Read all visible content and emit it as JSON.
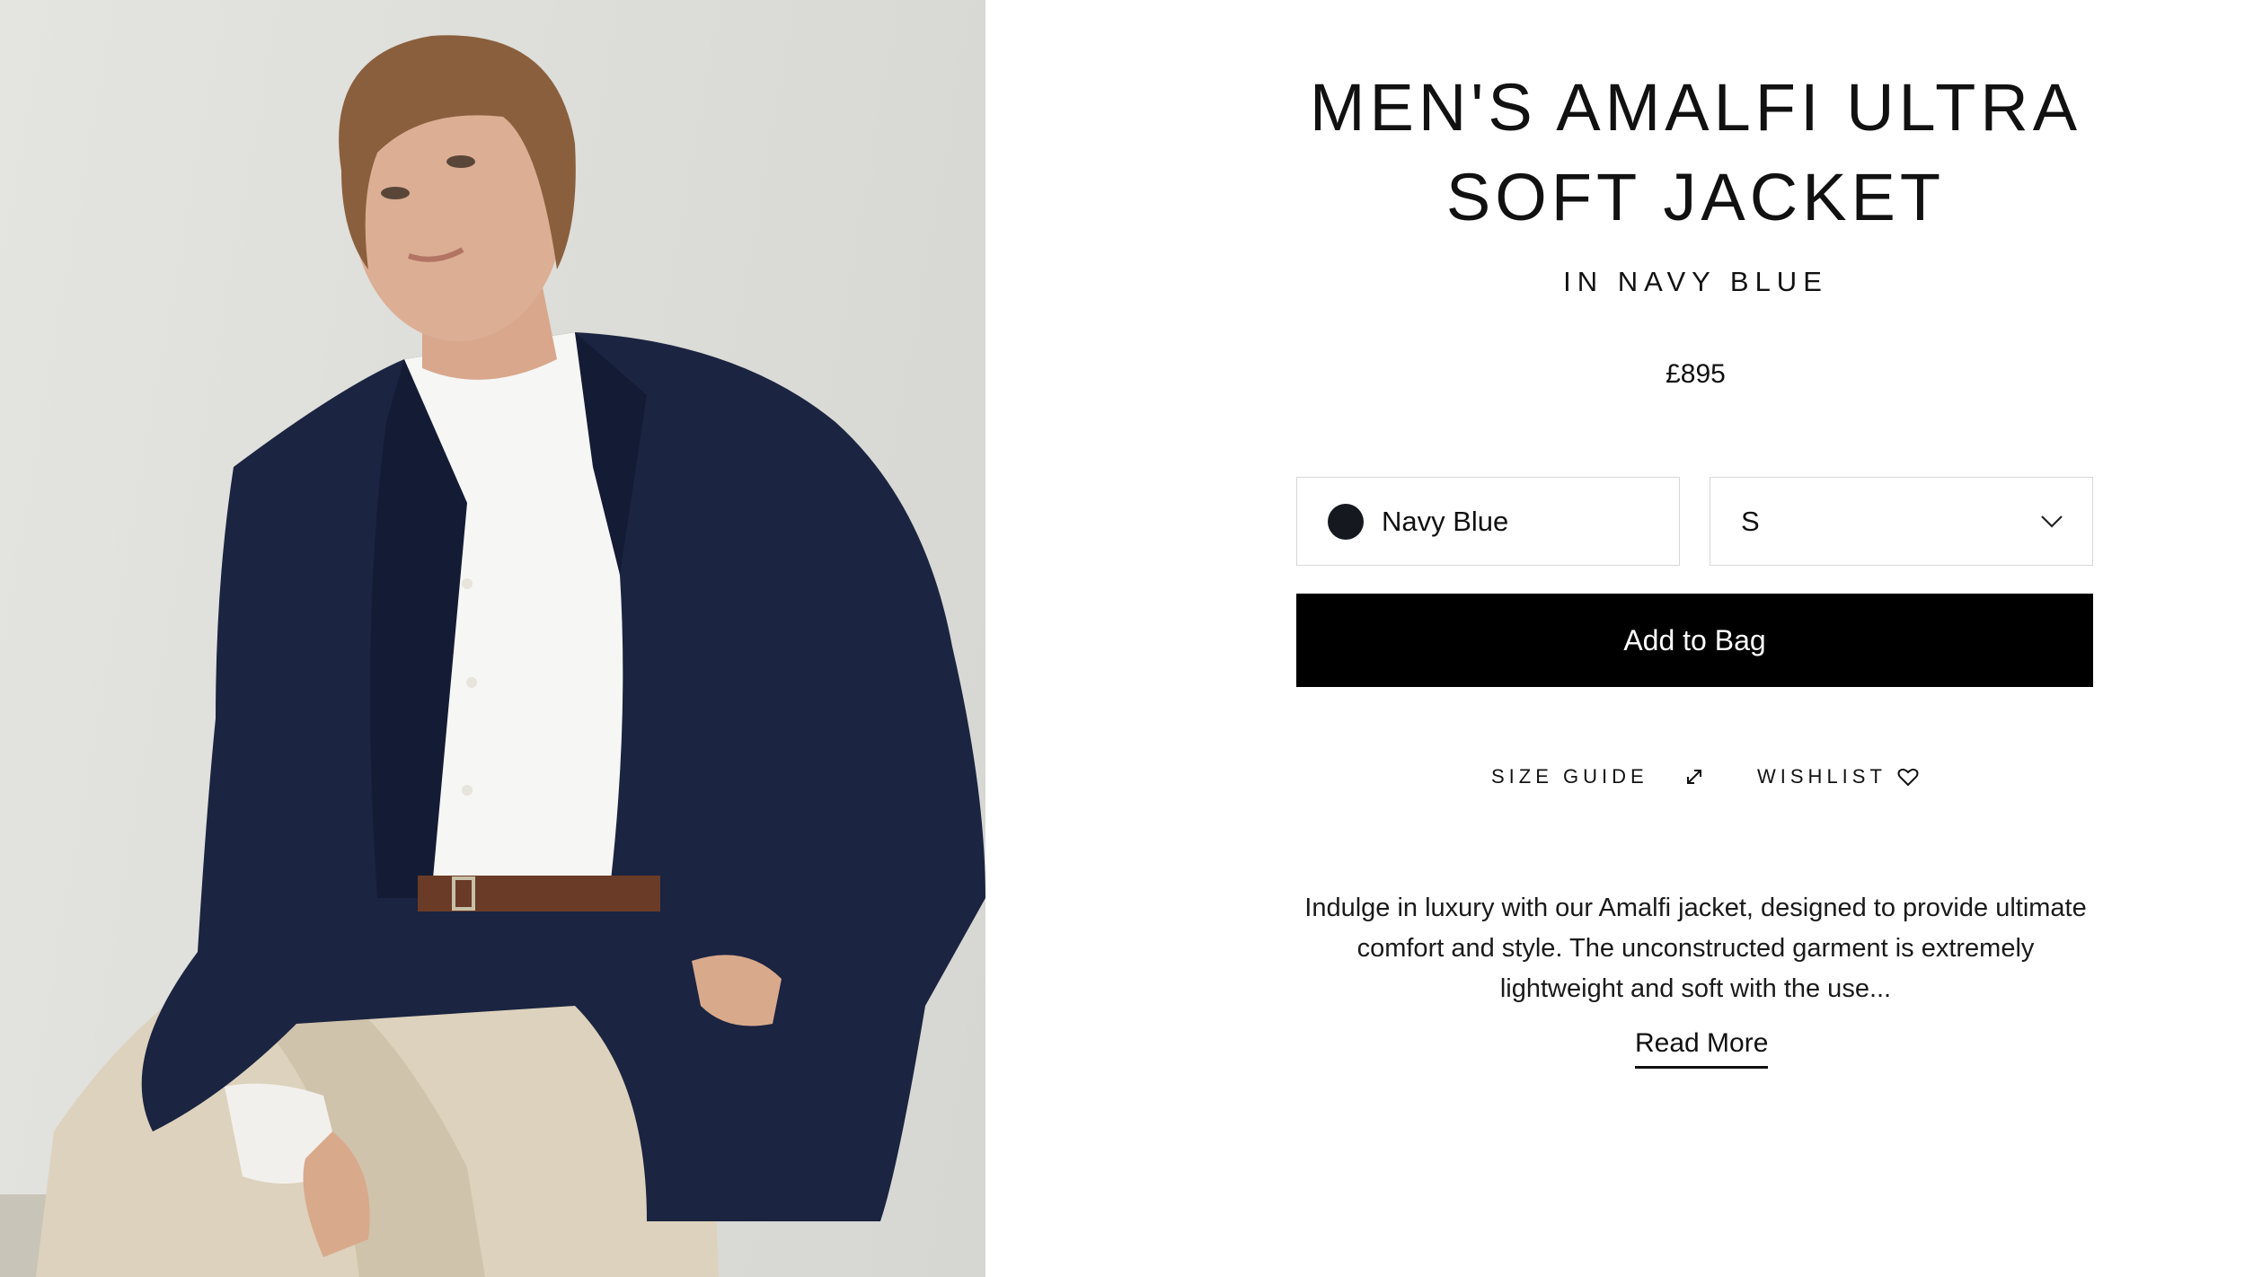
{
  "product": {
    "title": "MEN'S AMALFI ULTRA SOFT JACKET",
    "subtitle": "IN NAVY BLUE",
    "price": "£895",
    "image_alt": "Model wearing navy blue Amalfi jacket"
  },
  "selectors": {
    "color_value": "Navy Blue",
    "color_swatch": "#15191f",
    "size_value": "S"
  },
  "actions": {
    "add_to_bag": "Add to Bag",
    "size_guide": "SIZE GUIDE",
    "wishlist": "WISHLIST",
    "read_more": "Read More"
  },
  "description": "Indulge in luxury with our Amalfi jacket, designed to provide ultimate comfort and style. The unconstructed garment is extremely lightweight and soft with the use...",
  "icons": {
    "size_guide": "expand-arrows-icon",
    "wishlist": "heart-icon",
    "size_dropdown": "chevron-down-icon"
  }
}
